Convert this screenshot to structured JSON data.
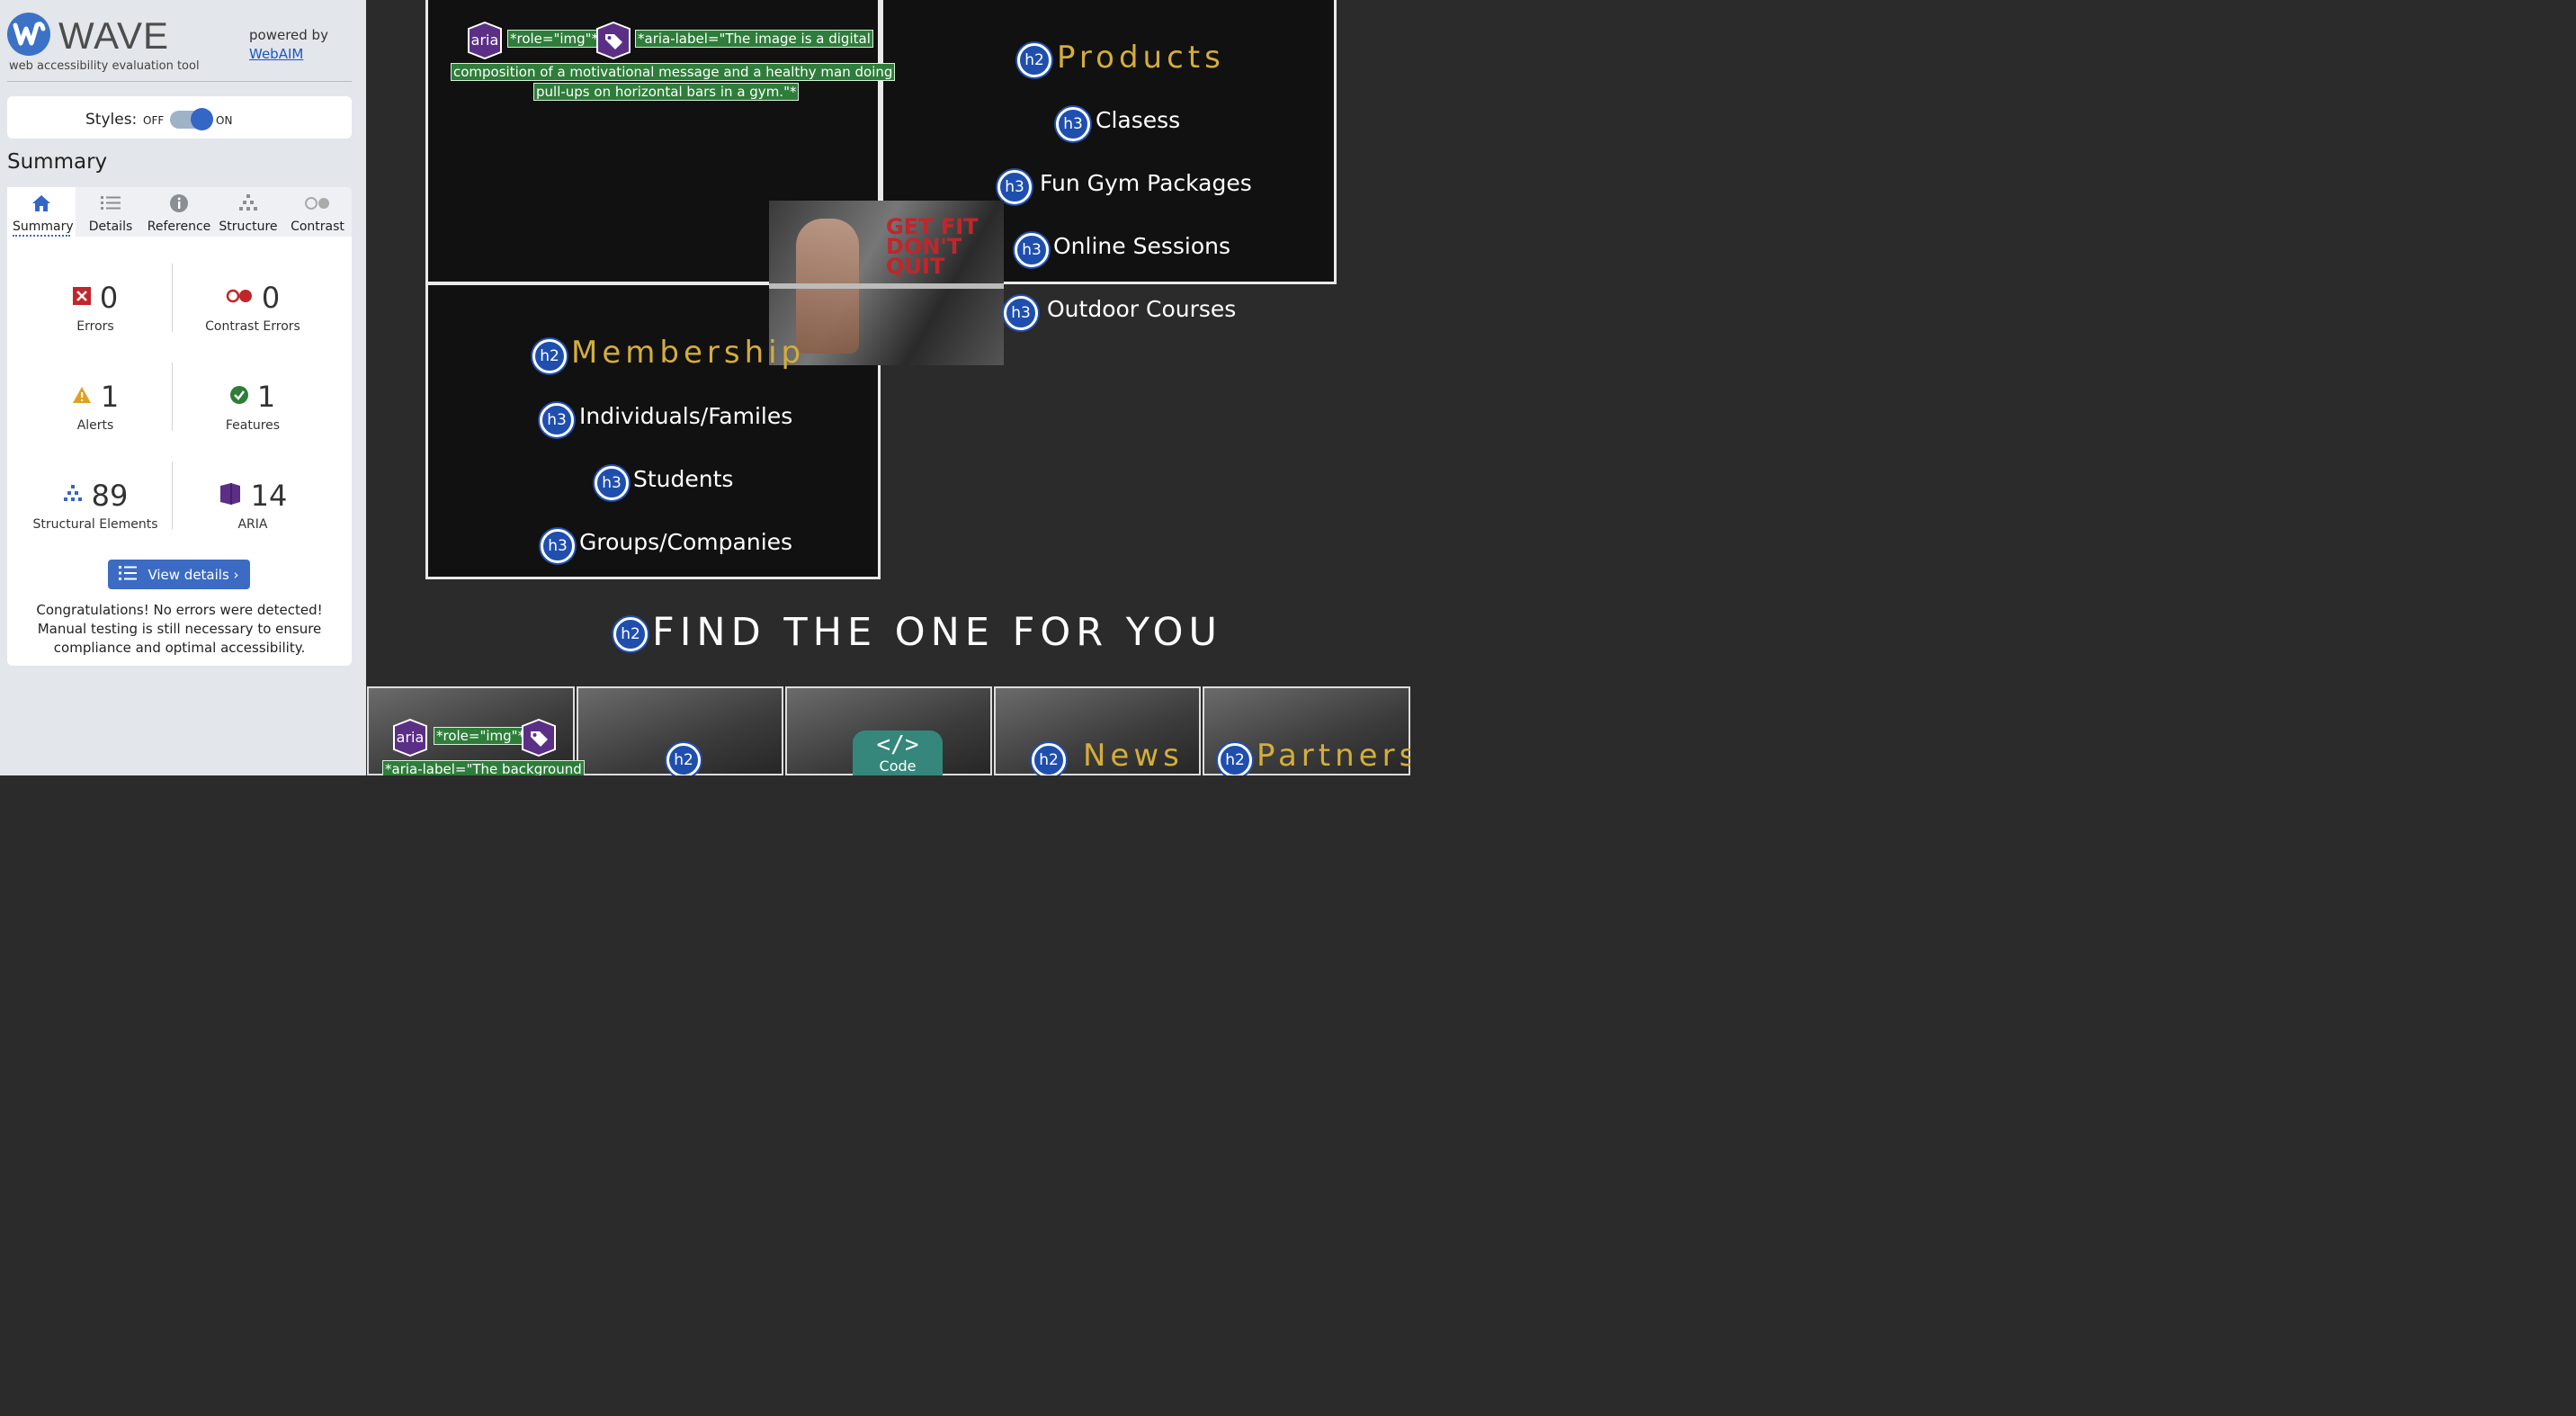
{
  "wave": {
    "logo_text": "WAVE",
    "tagline": "web accessibility evaluation tool",
    "powered_by": "powered by",
    "webaim_link": "WebAIM",
    "styles_label": "Styles:",
    "styles_off": "OFF",
    "styles_on": "ON",
    "styles_state": "on",
    "summary_heading": "Summary",
    "tabs": [
      {
        "label": "Summary",
        "icon": "home-icon",
        "active": true
      },
      {
        "label": "Details",
        "icon": "list-icon"
      },
      {
        "label": "Reference",
        "icon": "info-icon"
      },
      {
        "label": "Structure",
        "icon": "structure-icon"
      },
      {
        "label": "Contrast",
        "icon": "contrast-icon"
      }
    ],
    "stats": {
      "errors": {
        "count": "0",
        "label": "Errors",
        "color": "#c0262b"
      },
      "contrast_errors": {
        "count": "0",
        "label": "Contrast Errors",
        "color": "#c0262b"
      },
      "alerts": {
        "count": "1",
        "label": "Alerts",
        "color": "#e0a020"
      },
      "features": {
        "count": "1",
        "label": "Features",
        "color": "#2e7d3a"
      },
      "structural": {
        "count": "89",
        "label": "Structural Elements",
        "color": "#3466c6"
      },
      "aria": {
        "count": "14",
        "label": "ARIA",
        "color": "#5b2f86"
      }
    },
    "view_details": "View details ›",
    "congrats": "Congratulations! No errors were detected! Manual testing is still necessary to ensure compliance and optimal accessibility."
  },
  "page": {
    "aria_label": "aria",
    "role_img": "*role=\"img\"*",
    "aria_label_line1": "*aria-label=\"The image is a digital",
    "aria_label_line2": "composition of a motivational message and a healthy man doing",
    "aria_label_line3": "pull-ups on horizontal bars in a gym.\"*",
    "h2": "h2",
    "h3": "h3",
    "products": "Products",
    "products_items": [
      "Clasess",
      "Fun Gym Packages",
      "Online Sessions",
      "Outdoor Courses"
    ],
    "membership": "Membership",
    "membership_items": [
      "Individuals/Familes",
      "Students",
      "Groups/Companies"
    ],
    "gym_image_text": "GET FIT DON'T QUIT",
    "find_heading": "FIND THE ONE FOR YOU",
    "bottom_role_img": "*role=\"img\"*",
    "bottom_aria_label": "*aria-label=\"The background",
    "news": "News",
    "partners": "Partners",
    "code_button": "Code"
  }
}
